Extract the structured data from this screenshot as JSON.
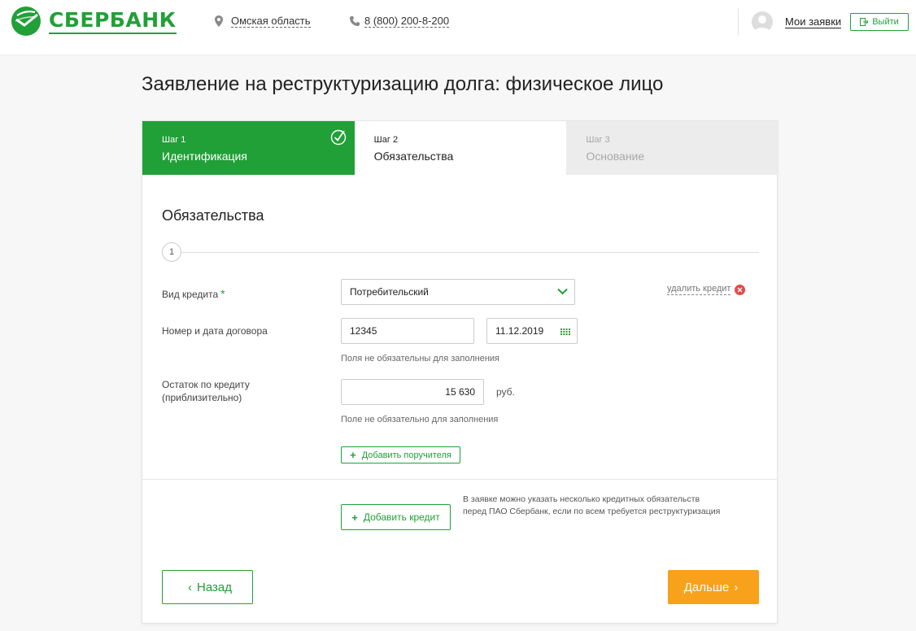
{
  "header": {
    "logo_text": "СБЕРБАНК",
    "region": "Омская область",
    "phone": "8 (800) 200-8-200",
    "my_applications": "Мои заявки",
    "logout_label": "Выйти"
  },
  "page": {
    "title": "Заявление на реструктуризацию долга: физическое лицо"
  },
  "steps": [
    {
      "number": "Шаг 1",
      "name": "Идентификация",
      "state": "done"
    },
    {
      "number": "Шаг 2",
      "name": "Обязательства",
      "state": "active"
    },
    {
      "number": "Шаг 3",
      "name": "Основание",
      "state": "todo"
    }
  ],
  "form": {
    "section_title": "Обязательства",
    "item_number": "1",
    "credit_type_label": "Вид кредита",
    "credit_type_required": "*",
    "credit_type_value": "Потребительский",
    "delete_credit": "удалить кредит",
    "contract_label": "Номер и дата договора",
    "contract_number": "12345",
    "contract_date": "11.12.2019",
    "contract_hint": "Поля не обязательны для заполнения",
    "balance_label_line1": "Остаток по кредиту",
    "balance_label_line2": "(приблизительно)",
    "balance_value": "15 630",
    "balance_unit": "руб.",
    "balance_hint": "Поле не обязательно для заполнения",
    "add_guarantor": "Добавить поручителя",
    "add_credit": "Добавить кредит",
    "add_credit_note": "В заявке можно указать несколько кредитных обязательств перед ПАО Сбербанк, если по всем требуется реструктуризация"
  },
  "nav": {
    "back": "Назад",
    "next": "Дальше"
  },
  "colors": {
    "brand_green": "#21a038",
    "next_orange": "#f7a21a",
    "error_red": "#e24b4b"
  },
  "icons": {
    "logo": "sberbank-logo-icon",
    "region": "location-pin-icon",
    "phone": "phone-icon",
    "avatar": "user-avatar-icon",
    "logout": "logout-icon",
    "step_done": "check-circle-icon",
    "select": "chevron-down-icon",
    "delete": "close-circle-icon",
    "calendar": "calendar-icon"
  }
}
